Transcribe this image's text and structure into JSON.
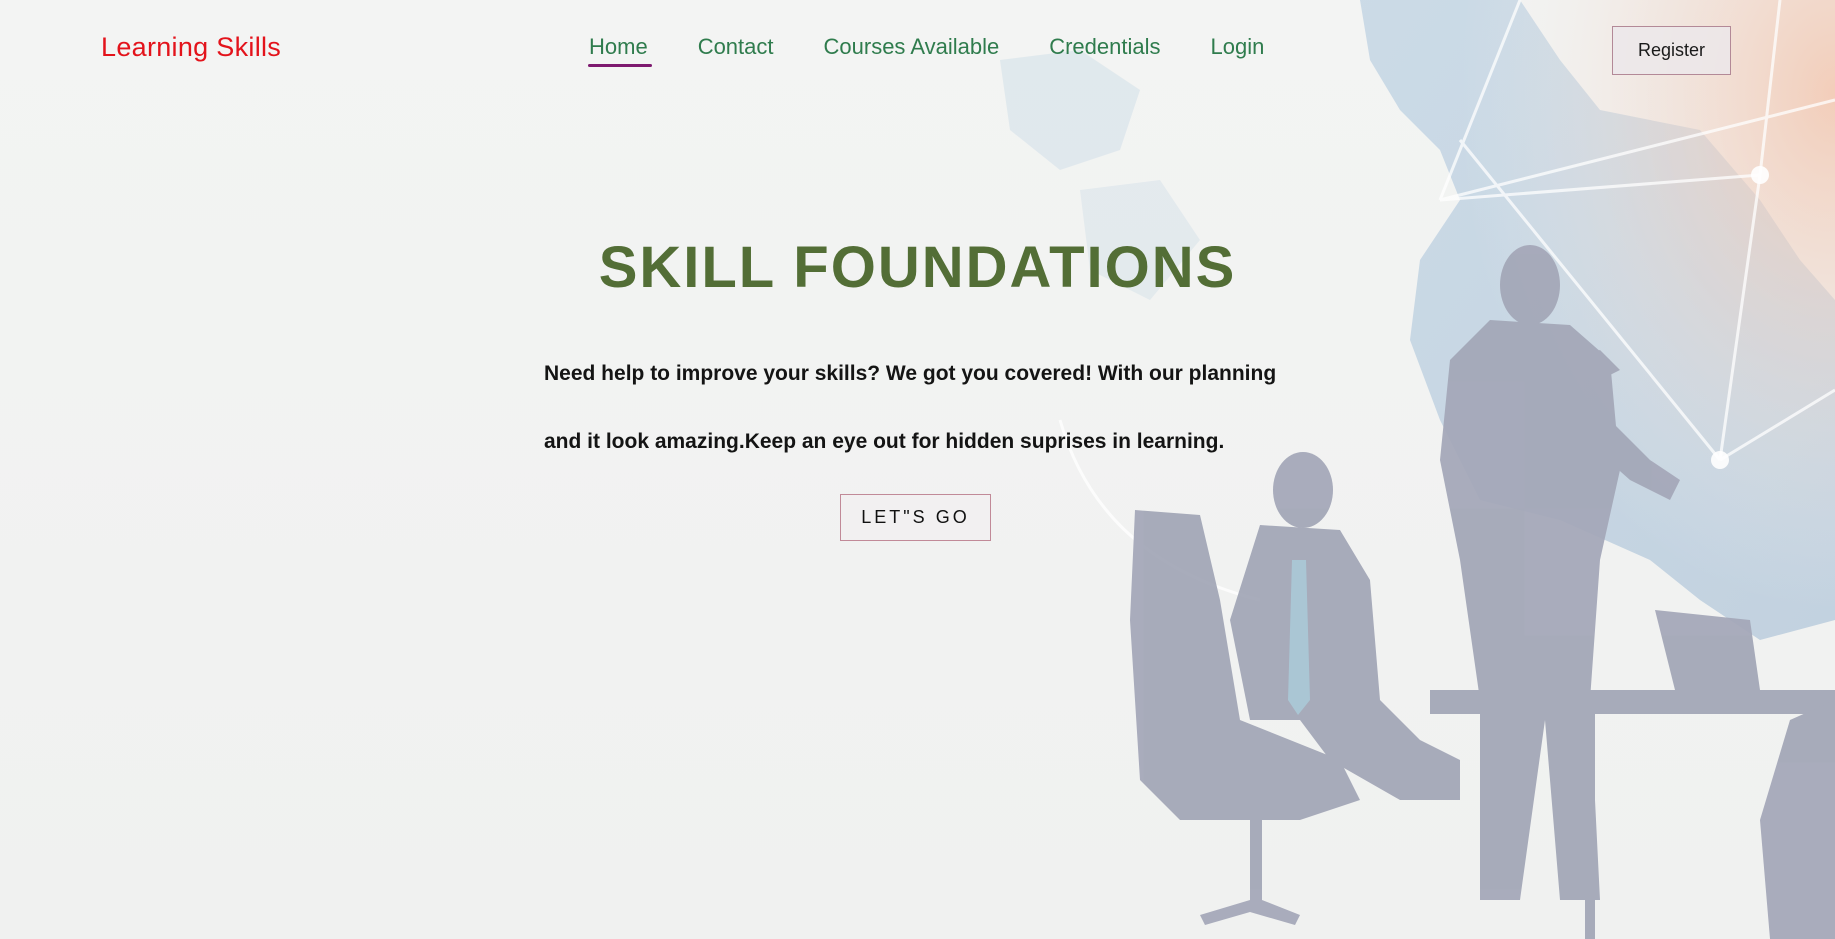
{
  "brand": {
    "name": "Learning Skills"
  },
  "nav": {
    "items": [
      {
        "label": "Home",
        "active": true
      },
      {
        "label": "Contact",
        "active": false
      },
      {
        "label": "Courses Available",
        "active": false
      },
      {
        "label": "Credentials",
        "active": false
      },
      {
        "label": "Login",
        "active": false
      }
    ],
    "register_label": "Register"
  },
  "hero": {
    "title": "SKILL FOUNDATIONS",
    "line1": "Need help to improve your skills? We got you covered! With our planning",
    "line2": "and it look amazing.Keep an eye out for hidden suprises in learning.",
    "cta_label": "LET\"S GO"
  },
  "colors": {
    "brand": "#e3131b",
    "nav_link": "#2f7c4d",
    "nav_active_underline": "#7d1a6f",
    "hero_title": "#536e36",
    "button_border": "#b38997"
  }
}
